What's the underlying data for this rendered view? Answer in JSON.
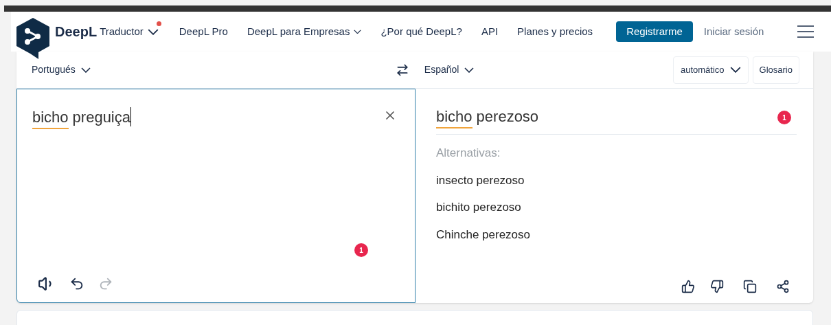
{
  "nav": {
    "brand": "DeepL",
    "product": "Traductor",
    "product_notification": true,
    "items": [
      {
        "label": "DeepL Pro",
        "has_menu": false
      },
      {
        "label": "DeepL para Empresas",
        "has_menu": true
      },
      {
        "label": "¿Por qué DeepL?",
        "has_menu": false
      },
      {
        "label": "API",
        "has_menu": false
      },
      {
        "label": "Planes y precios",
        "has_menu": false
      }
    ],
    "signup": "Registrarme",
    "login": "Iniciar sesión"
  },
  "source": {
    "language": "Portugués",
    "words": [
      {
        "text": "bicho",
        "underlined": true
      },
      {
        "text": "preguiça",
        "underlined": false
      }
    ],
    "badge": "1",
    "redo_disabled": true
  },
  "target": {
    "language": "Español",
    "formality": "automático",
    "glossary": "Glosario",
    "words": [
      {
        "text": "bicho",
        "underlined": true
      },
      {
        "text": "perezoso",
        "underlined": false
      }
    ],
    "badge": "1",
    "alternatives_label": "Alternativas:",
    "alternatives": [
      "insecto perezoso",
      "bichito perezoso",
      "Chinche perezoso"
    ]
  }
}
